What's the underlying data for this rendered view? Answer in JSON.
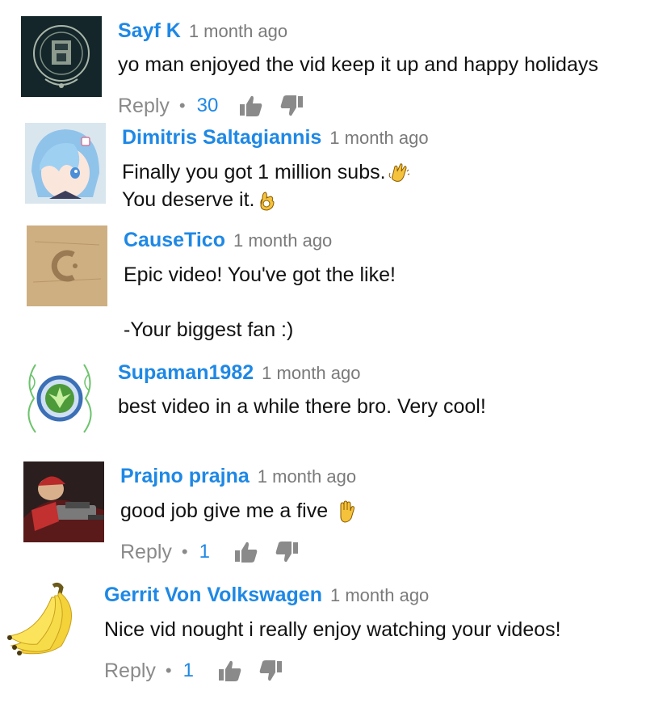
{
  "comments": [
    {
      "author": "Sayf K",
      "time": "1 month ago",
      "lines": [
        "yo man enjoyed the vid keep it up and happy holidays"
      ],
      "reply_label": "Reply",
      "likes": "30",
      "avatar": "dark-emblem-avatar"
    },
    {
      "author": "Dimitris Saltagiannis",
      "time": "1 month ago",
      "lines": [
        "Finally you got 1 million subs.",
        "You deserve it."
      ],
      "emojis": [
        "clapping-hands-emoji",
        "ok-hand-emoji"
      ],
      "avatar": "anime-girl-avatar"
    },
    {
      "author": "CauseTico",
      "time": "1 month ago",
      "lines": [
        "Epic video! You've got the like!",
        "",
        "-Your biggest fan :)"
      ],
      "avatar": "cardboard-logo-avatar"
    },
    {
      "author": "Supaman1982",
      "time": "1 month ago",
      "lines": [
        "best video in a while there bro. Very cool!"
      ],
      "avatar": "leaf-emblem-avatar"
    },
    {
      "author": "Prajno prajna",
      "time": "1 month ago",
      "lines": [
        "good job give me a five"
      ],
      "emojis": [
        "raised-hand-emoji"
      ],
      "reply_label": "Reply",
      "likes": "1",
      "avatar": "game-character-avatar"
    },
    {
      "author": "Gerrit Von Volkswagen",
      "time": "1 month ago",
      "lines": [
        "Nice vid nought i really enjoy watching your videos!"
      ],
      "reply_label": "Reply",
      "likes": "1",
      "avatar": "banana-avatar"
    }
  ],
  "colors": {
    "author": "#1e88e5",
    "timestamp": "#7a7a7a",
    "text": "#111111",
    "reply": "#8a8a8a",
    "like_count": "#1e88e5",
    "thumb_icons": "#8a8a8a"
  },
  "separator": "•"
}
